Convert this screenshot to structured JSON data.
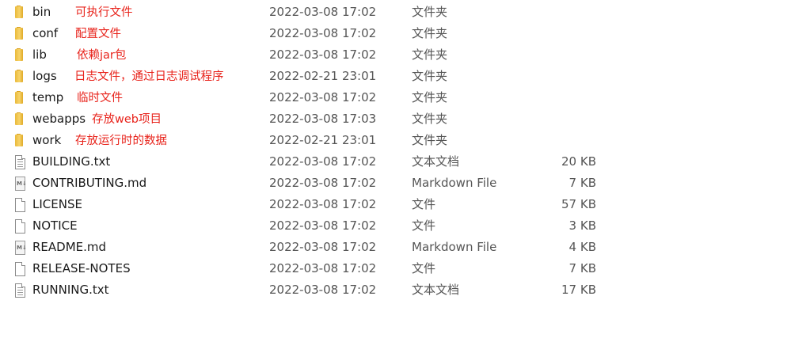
{
  "files": [
    {
      "name": "bin",
      "kind": "folder",
      "icon": "folder-icon",
      "note": "可执行文件",
      "date": "2022-03-08 17:02",
      "type": "文件夹",
      "size": ""
    },
    {
      "name": "conf",
      "kind": "folder",
      "icon": "folder-icon",
      "note": "配置文件",
      "date": "2022-03-08 17:02",
      "type": "文件夹",
      "size": ""
    },
    {
      "name": "lib",
      "kind": "folder",
      "icon": "folder-icon",
      "note": "依赖jar包",
      "date": "2022-03-08 17:02",
      "type": "文件夹",
      "size": ""
    },
    {
      "name": "logs",
      "kind": "folder",
      "icon": "folder-icon",
      "note": "日志文件，通过日志调试程序",
      "date": "2022-02-21 23:01",
      "type": "文件夹",
      "size": ""
    },
    {
      "name": "temp",
      "kind": "folder",
      "icon": "folder-icon",
      "note": "临时文件",
      "date": "2022-03-08 17:02",
      "type": "文件夹",
      "size": ""
    },
    {
      "name": "webapps",
      "kind": "folder",
      "icon": "folder-icon",
      "note": "存放web项目",
      "date": "2022-03-08 17:03",
      "type": "文件夹",
      "size": ""
    },
    {
      "name": "work",
      "kind": "folder",
      "icon": "folder-icon",
      "note": "存放运行时的数据",
      "date": "2022-02-21 23:01",
      "type": "文件夹",
      "size": ""
    },
    {
      "name": "BUILDING.txt",
      "kind": "text",
      "icon": "text-document-icon",
      "note": "",
      "date": "2022-03-08 17:02",
      "type": "文本文档",
      "size": "20 KB"
    },
    {
      "name": "CONTRIBUTING.md",
      "kind": "markdown",
      "icon": "markdown-file-icon",
      "note": "",
      "date": "2022-03-08 17:02",
      "type": "Markdown File",
      "size": "7 KB"
    },
    {
      "name": "LICENSE",
      "kind": "plain",
      "icon": "file-icon",
      "note": "",
      "date": "2022-03-08 17:02",
      "type": "文件",
      "size": "57 KB"
    },
    {
      "name": "NOTICE",
      "kind": "plain",
      "icon": "file-icon",
      "note": "",
      "date": "2022-03-08 17:02",
      "type": "文件",
      "size": "3 KB"
    },
    {
      "name": "README.md",
      "kind": "markdown",
      "icon": "markdown-file-icon",
      "note": "",
      "date": "2022-03-08 17:02",
      "type": "Markdown File",
      "size": "4 KB"
    },
    {
      "name": "RELEASE-NOTES",
      "kind": "plain",
      "icon": "file-icon",
      "note": "",
      "date": "2022-03-08 17:02",
      "type": "文件",
      "size": "7 KB"
    },
    {
      "name": "RUNNING.txt",
      "kind": "text",
      "icon": "text-document-icon",
      "note": "",
      "date": "2022-03-08 17:02",
      "type": "文本文档",
      "size": "17 KB"
    }
  ],
  "colors": {
    "annotation": "#e8231b",
    "folder": "#f0c244",
    "meta_text": "#555555"
  }
}
